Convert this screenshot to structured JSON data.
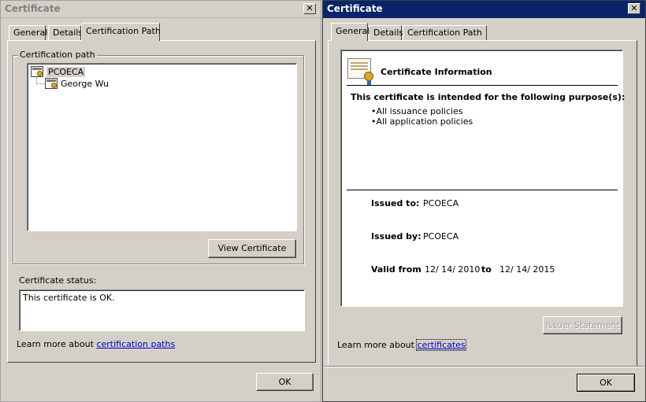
{
  "left_window": {
    "title": "Certificate",
    "close_glyph": "✕",
    "tabs": [
      {
        "label": "General"
      },
      {
        "label": "Details"
      },
      {
        "label": "Certification Path"
      }
    ],
    "path_group_label": "Certification path",
    "tree": [
      {
        "label": "PCOECA",
        "selected": true
      },
      {
        "label": "George Wu",
        "selected": false
      }
    ],
    "view_certificate_label": "View Certificate",
    "status_label": "Certificate status:",
    "status_text": "This certificate is OK.",
    "learn_prefix": "Learn more about ",
    "learn_link": "certification paths",
    "ok_label": "OK"
  },
  "right_window": {
    "title": "Certificate",
    "close_glyph": "✕",
    "tabs": [
      {
        "label": "General"
      },
      {
        "label": "Details"
      },
      {
        "label": "Certification Path"
      }
    ],
    "info_title": "Certificate Information",
    "purpose_heading": "This certificate is intended for the following purpose(s):",
    "purposes": [
      "All issuance policies",
      "All application policies"
    ],
    "issued_to_label": "Issued to:",
    "issued_to_value": "PCOECA",
    "issued_by_label": "Issued by:",
    "issued_by_value": "PCOECA",
    "valid_from_label": "Valid from",
    "valid_from_value": "12/ 14/ 2010",
    "valid_to_label": "to",
    "valid_to_value": "12/ 14/ 2015",
    "issuer_statement_label": "Issuer Statement",
    "learn_prefix": "Learn more about ",
    "learn_link": "certificates",
    "ok_label": "OK"
  },
  "colors": {
    "active_titlebar": "#0a246a",
    "inactive_title_text": "#808080",
    "dialog_face": "#d4d0c8",
    "link": "#0000cc"
  }
}
